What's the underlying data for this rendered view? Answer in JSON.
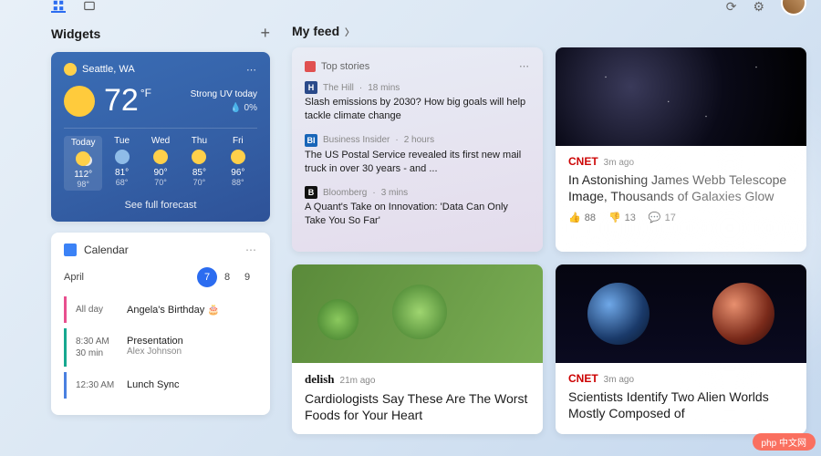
{
  "widgets": {
    "title": "Widgets"
  },
  "weather": {
    "location": "Seattle, WA",
    "temp": "72",
    "unit": "°F",
    "uv": "Strong UV today",
    "precip": "0%",
    "forecast": [
      {
        "day": "Today",
        "hi": "112°",
        "lo": "98°"
      },
      {
        "day": "Tue",
        "hi": "81°",
        "lo": "68°"
      },
      {
        "day": "Wed",
        "hi": "90°",
        "lo": "70°"
      },
      {
        "day": "Thu",
        "hi": "85°",
        "lo": "70°"
      },
      {
        "day": "Fri",
        "hi": "96°",
        "lo": "88°"
      }
    ],
    "link": "See full forecast"
  },
  "calendar": {
    "title": "Calendar",
    "month": "April",
    "days": [
      "7",
      "8",
      "9"
    ],
    "events": [
      {
        "time": "All day",
        "dur": "",
        "title": "Angela's Birthday 🎂",
        "sub": ""
      },
      {
        "time": "8:30 AM",
        "dur": "30 min",
        "title": "Presentation",
        "sub": "Alex Johnson"
      },
      {
        "time": "12:30 AM",
        "dur": "",
        "title": "Lunch Sync",
        "sub": ""
      }
    ]
  },
  "feed": {
    "title": "My feed",
    "topstories_label": "Top stories",
    "stories": [
      {
        "src": "The Hill",
        "ago": "18 mins",
        "srcic": "H",
        "srcbg": "#2a4a8a",
        "headline": "Slash emissions by 2030? How big goals will help tackle climate change"
      },
      {
        "src": "Business Insider",
        "ago": "2 hours",
        "srcic": "BI",
        "srcbg": "#1865b8",
        "headline": "The US Postal Service revealed its first new mail truck in over 30 years - and ..."
      },
      {
        "src": "Bloomberg",
        "ago": "3 mins",
        "srcic": "B",
        "srcbg": "#111",
        "headline": "A Quant's Take on Innovation: 'Data Can Only Take You So Far'"
      }
    ],
    "cards": {
      "cnet1": {
        "brand": "CNET",
        "ago": "3m ago",
        "title": "In Astonishing James Webb Telescope Image, Thousands of Galaxies Glow",
        "like": "88",
        "dislike": "13",
        "comment": "17"
      },
      "delish": {
        "brand": "delish",
        "ago": "21m ago",
        "title": "Cardiologists Say These Are The Worst Foods for Your Heart"
      },
      "cnet2": {
        "brand": "CNET",
        "ago": "3m ago",
        "title": "Scientists Identify Two Alien Worlds Mostly Composed of"
      }
    }
  },
  "watermark": "php 中文网"
}
